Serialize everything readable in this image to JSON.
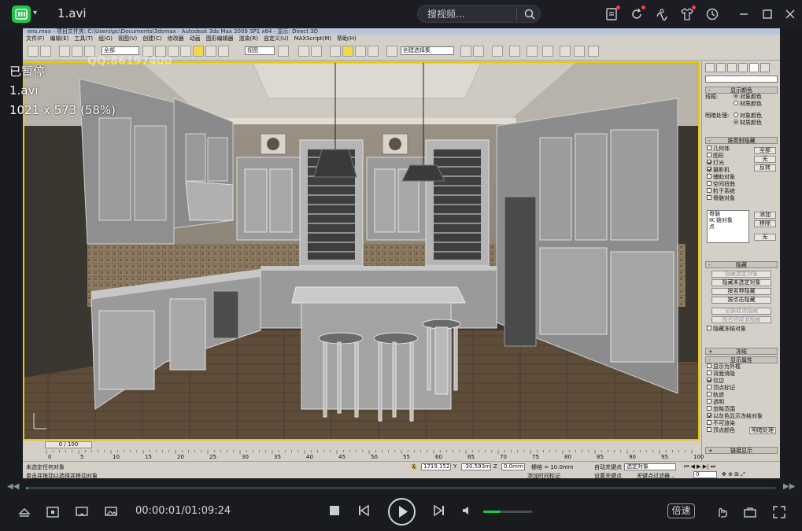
{
  "player": {
    "file_title": "1.avi",
    "search_placeholder": "搜视频...",
    "osd": {
      "status": "已暂停",
      "filename": "1.avi",
      "resolution": "1021 x 573 (58%)"
    },
    "current_time": "00:00:01",
    "total_time": "01:09:24",
    "time_display": "00:00:01/01:09:24",
    "speed_label": "倍速",
    "seek_progress": 0.0003,
    "volume_level": 0.35,
    "colors": {
      "accent": "#1ec74a",
      "badge": "#ff3b3b",
      "bar": "#1c1d22"
    }
  },
  "max": {
    "title_text": "ens.max  - 项目文件夹: C:\\Users\\pc\\Documents\\3dsmax  - Autodesk 3ds Max 2009 SP1 x64  - 显示: Direct 3D",
    "menu": [
      "文件(F)",
      "编辑(E)",
      "工具(T)",
      "组(G)",
      "视图(V)",
      "创建(C)",
      "修改器",
      "动画",
      "图形编辑器",
      "渲染(R)",
      "自定义(U)",
      "MAXScript(M)",
      "帮助(H)"
    ],
    "toolbar": {
      "select_filter": "全部",
      "view_dropdown": "视图",
      "named_selection": "创建选择集"
    },
    "watermark": "QQ:86197400",
    "command_panel": {
      "display_color": {
        "header": "显示颜色",
        "wireframe_label": "线框:",
        "wireframe_options": [
          "对象颜色",
          "材质颜色"
        ],
        "shaded_label": "明暗处理:",
        "shaded_options": [
          "对象颜色",
          "材质颜色"
        ]
      },
      "hide_by_category": {
        "header": "按类别隐藏",
        "items": [
          {
            "label": "几何体",
            "checked": false
          },
          {
            "label": "图形",
            "checked": false
          },
          {
            "label": "灯光",
            "checked": true
          },
          {
            "label": "摄影机",
            "checked": true
          },
          {
            "label": "辅助对象",
            "checked": false
          },
          {
            "label": "空间扭曲",
            "checked": false
          },
          {
            "label": "粒子系统",
            "checked": false
          },
          {
            "label": "骨骼对象",
            "checked": false
          }
        ],
        "buttons": [
          "全部",
          "无",
          "反转"
        ],
        "list_items": [
          "骨骼",
          "IK 链对象",
          "点"
        ],
        "list_buttons": [
          "添加",
          "移除",
          "无"
        ]
      },
      "hide": {
        "header": "隐藏",
        "buttons": [
          "隐藏选定对象",
          "隐藏未选定对象",
          "按名称隐藏",
          "按点击隐藏",
          "全部取消隐藏",
          "按名称取消隐藏"
        ],
        "checkbox": "隐藏冻结对象"
      },
      "freeze": {
        "header": "冻结"
      },
      "display_properties": {
        "header": "显示属性",
        "items": [
          "显示为外框",
          "背面消隐",
          "仅边",
          "顶点标记",
          "轨迹",
          "透明",
          "忽略范围",
          "以灰色显示冻结对象",
          "不可渲染",
          "顶点颜色"
        ],
        "button": "明暗处理"
      },
      "link_display": {
        "header": "链接显示"
      }
    },
    "timeline": {
      "frame_label": "0 / 100",
      "ticks": [
        "0",
        "5",
        "10",
        "15",
        "20",
        "25",
        "30",
        "35",
        "40",
        "45",
        "50",
        "55",
        "60",
        "65",
        "70",
        "75",
        "80",
        "85",
        "90",
        "95",
        "100"
      ]
    },
    "status": {
      "selection": "未选定任何对象",
      "prompt": "单击并拖动以选择并移动对象",
      "x": "1719.152m",
      "y": "-30.593m",
      "z": "0.0mm",
      "grid": "栅格 = 10.0mm",
      "auto_key": "自动关键点",
      "set_key": "设置关键点",
      "selected_dropdown": "选定对象",
      "key_filters": "关键点过滤器...",
      "add_time_tag": "添加时间标记",
      "frame_field": "0"
    }
  }
}
